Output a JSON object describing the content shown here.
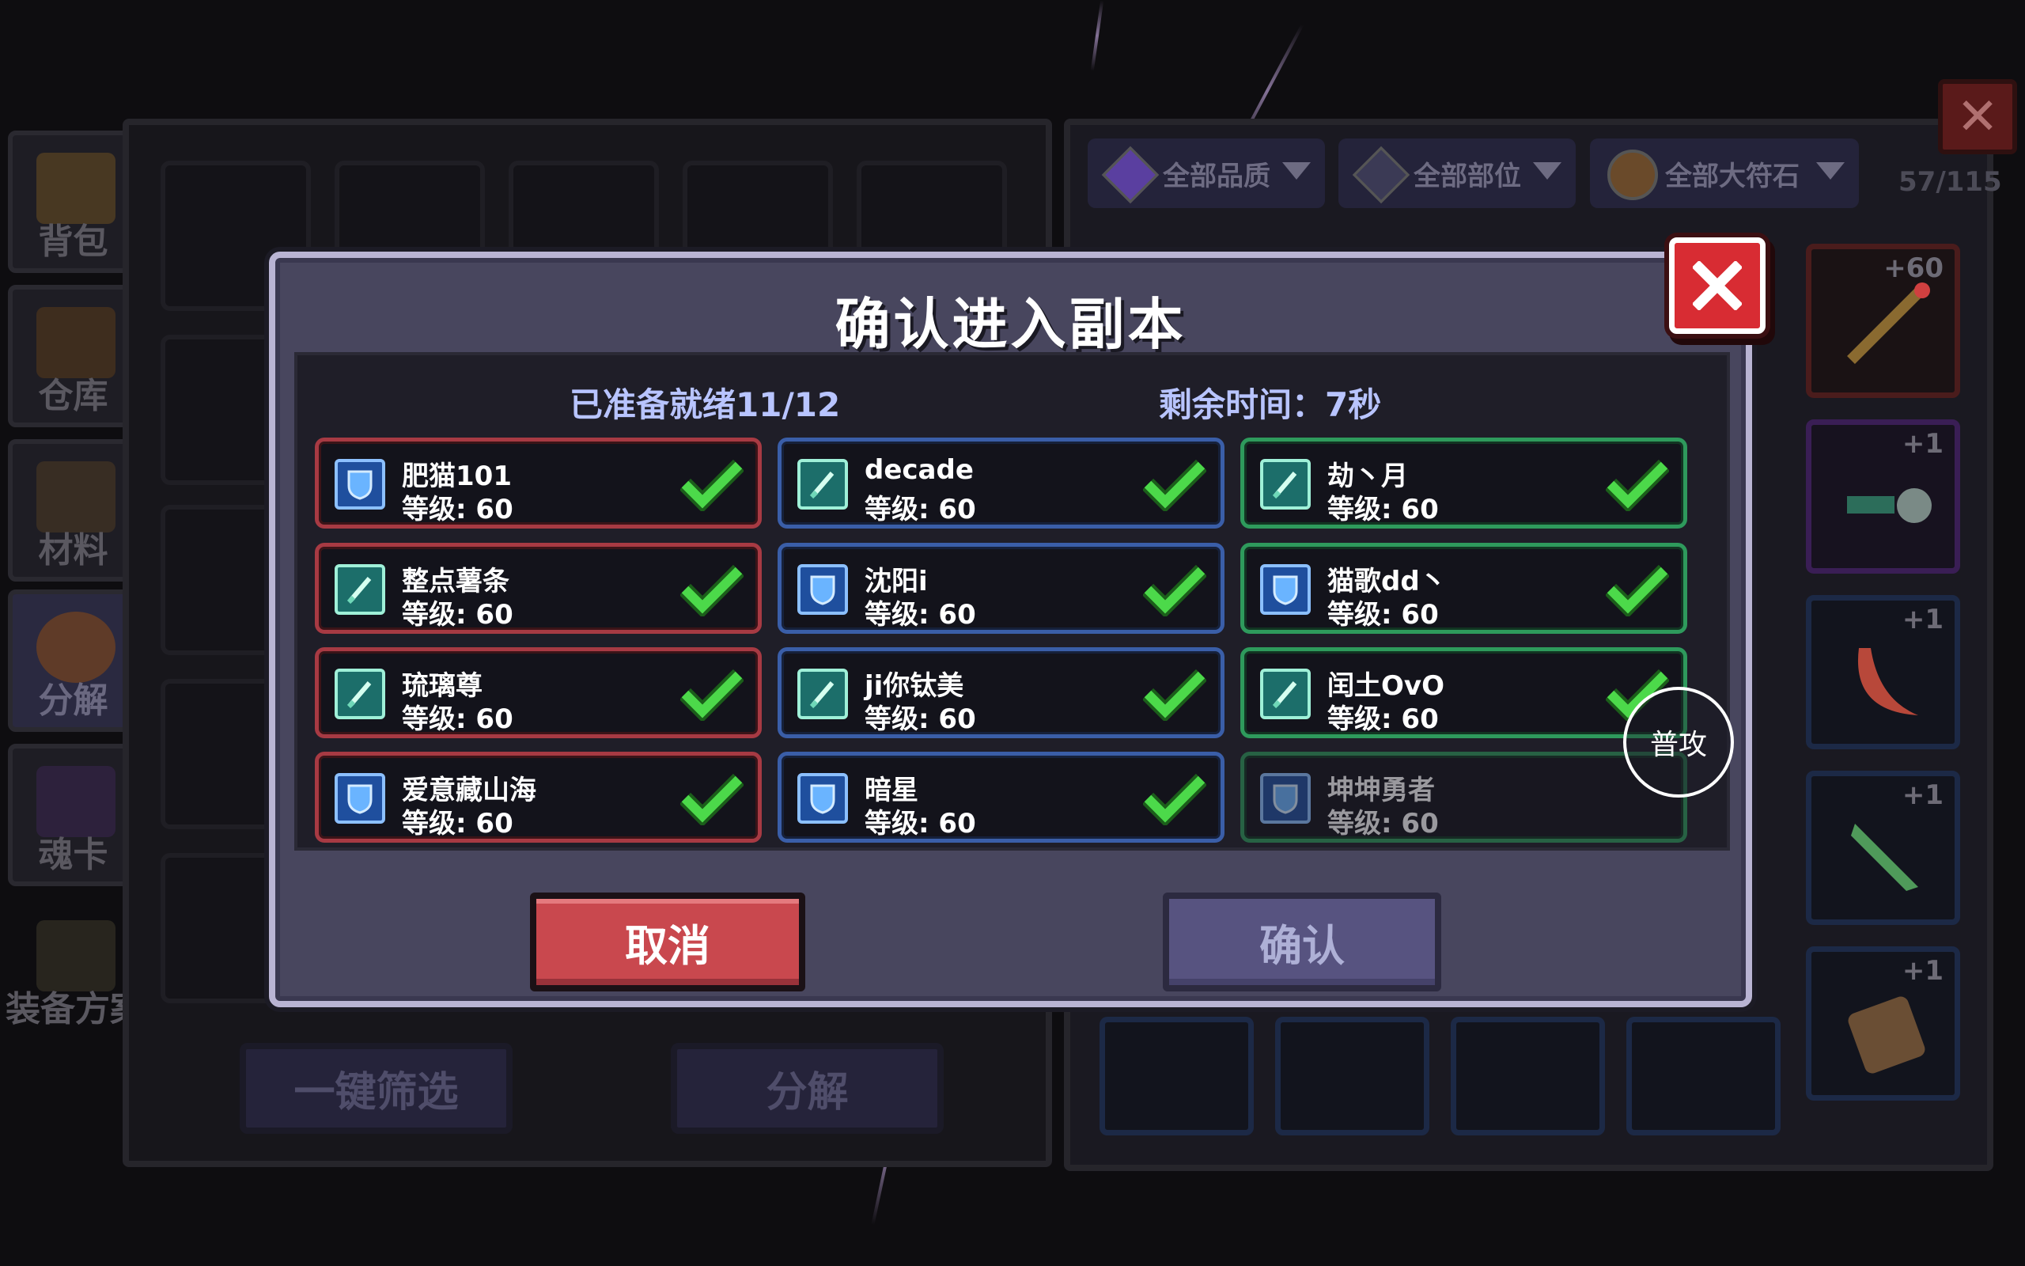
{
  "background": {
    "side_tabs": [
      "背包",
      "仓库",
      "材料",
      "分解",
      "魂卡",
      "装备方案"
    ],
    "bottom_buttons": {
      "filter": "一键筛选",
      "decompose": "分解"
    },
    "filters": [
      "全部品质",
      "全部部位",
      "全部大符石"
    ],
    "inventory_count": "57/115",
    "slot_badges": [
      "+60",
      "+1",
      "+1",
      "+1",
      "+1"
    ]
  },
  "modal": {
    "title": "确认进入副本",
    "ready_status": "已准备就绪11/12",
    "remaining_time": "剩余时间：7秒",
    "players": [
      {
        "name": "肥猫101",
        "level": "等级: 60",
        "role": "shield-icon",
        "team_color": "red",
        "ready": true
      },
      {
        "name": "decade",
        "level": "等级: 60",
        "role": "sword-icon",
        "team_color": "blue",
        "ready": true
      },
      {
        "name": "劫丶月",
        "level": "等级: 60",
        "role": "sword-icon",
        "team_color": "green",
        "ready": true
      },
      {
        "name": "整点薯条",
        "level": "等级: 60",
        "role": "sword-icon",
        "team_color": "red",
        "ready": true
      },
      {
        "name": "沈阳i",
        "level": "等级: 60",
        "role": "shield-icon",
        "team_color": "blue",
        "ready": true
      },
      {
        "name": "猫歌dd丶",
        "level": "等级: 60",
        "role": "shield-icon",
        "team_color": "green",
        "ready": true
      },
      {
        "name": "琉璃尊",
        "level": "等级: 60",
        "role": "sword-icon",
        "team_color": "red",
        "ready": true
      },
      {
        "name": "ji你钛美",
        "level": "等级: 60",
        "role": "sword-icon",
        "team_color": "blue",
        "ready": true
      },
      {
        "name": "闰土OvO",
        "level": "等级: 60",
        "role": "sword-icon",
        "team_color": "green",
        "ready": true
      },
      {
        "name": "爱意藏山海",
        "level": "等级: 60",
        "role": "shield-icon",
        "team_color": "red",
        "ready": true
      },
      {
        "name": "暗星",
        "level": "等级: 60",
        "role": "shield-icon",
        "team_color": "blue",
        "ready": true
      },
      {
        "name": "坤坤勇者",
        "level": "等级: 60",
        "role": "shield-icon",
        "team_color": "green",
        "ready": false
      }
    ],
    "cancel_label": "取消",
    "confirm_label": "确认"
  },
  "hud": {
    "attack_label": "普攻"
  },
  "colors": {
    "accent_red": "#d82c33",
    "ready_check": "#4cd94a",
    "team_red": "#a73a43",
    "team_blue": "#3a5ea8",
    "team_green": "#2e9a5c"
  }
}
